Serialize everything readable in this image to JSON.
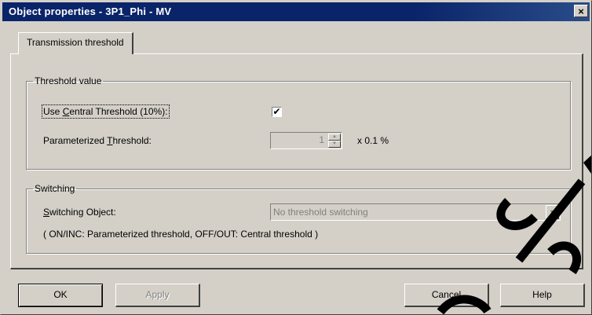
{
  "window": {
    "title": "Object properties - 3P1_Phi - MV",
    "close_glyph": "×"
  },
  "tabs": [
    {
      "label": "Transmission threshold",
      "active": true
    }
  ],
  "threshold_group": {
    "legend": "Threshold value",
    "use_central": {
      "label_prefix": "Use ",
      "label_accel": "C",
      "label_suffix": "entral Threshold (10%):",
      "checked": true,
      "check_glyph": "✔"
    },
    "parameterized": {
      "label_prefix": "Parameterized ",
      "label_accel": "T",
      "label_suffix": "hreshold:",
      "value": "1",
      "unit": "x 0.1 %",
      "enabled": false
    }
  },
  "switching_group": {
    "legend": "Switching",
    "object_label_accel": "S",
    "object_label_suffix": "witching Object:",
    "object_value": "No threshold switching",
    "enabled": false,
    "note": "( ON/INC: Parameterized threshold, OFF/OUT: Central threshold )"
  },
  "buttons": {
    "ok": "OK",
    "apply": "Apply",
    "cancel": "Cancel",
    "help": "Help"
  },
  "colors": {
    "face": "#d4d0c8",
    "titlebar": "#0a246a",
    "disabled_text": "#808080"
  },
  "icons": {
    "close": "close-icon",
    "spin_up": "arrow-up-icon",
    "spin_down": "arrow-down-icon",
    "dropdown": "chevron-down-icon"
  }
}
